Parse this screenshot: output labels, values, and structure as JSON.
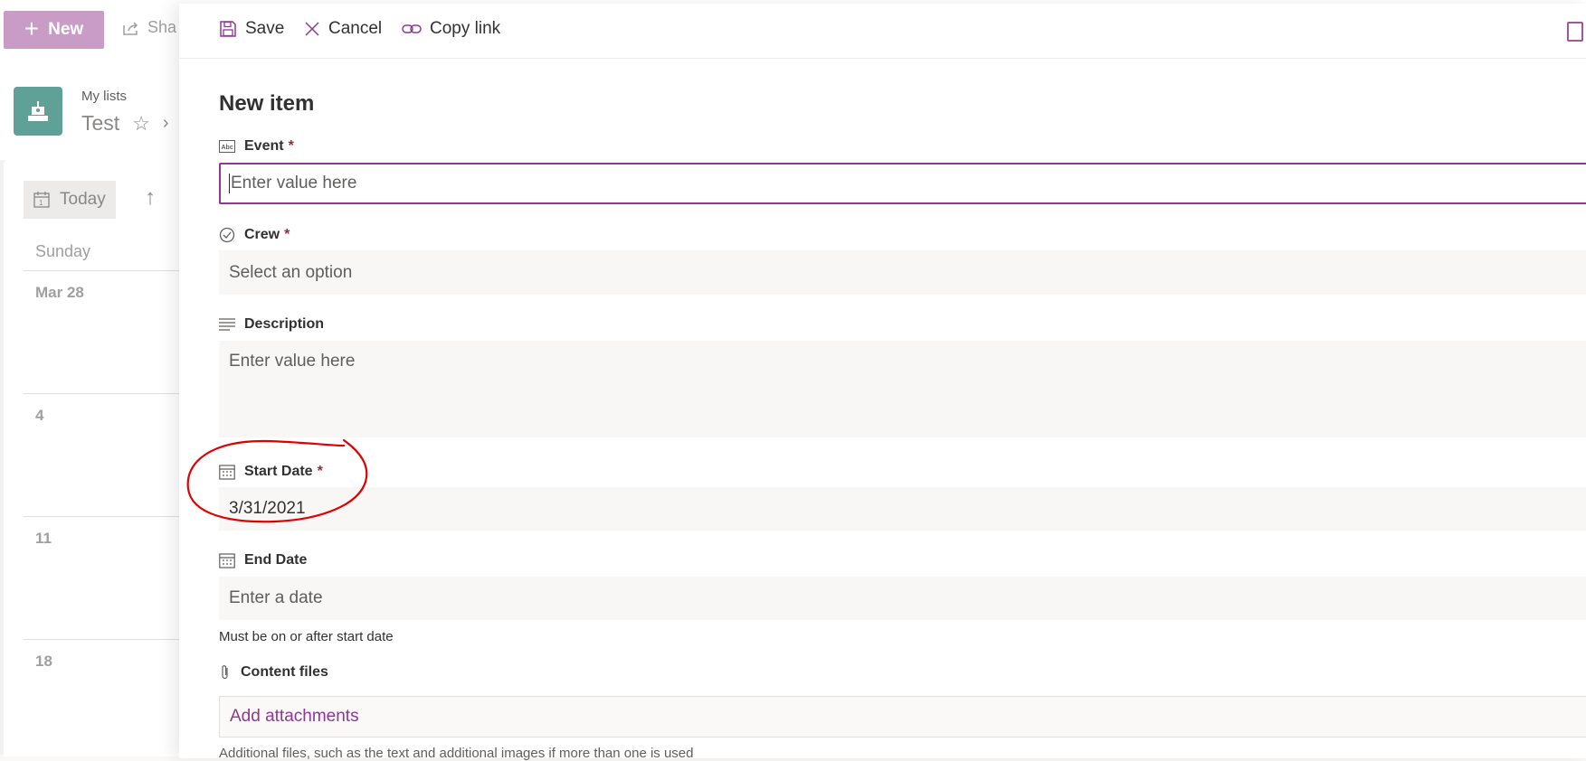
{
  "background": {
    "command_bar": {
      "new_label": "New",
      "share_label": "Sha"
    },
    "site": {
      "parent_breadcrumb": "My lists",
      "list_title": "Test"
    },
    "calendar": {
      "today_label": "Today",
      "day_of_week": "Sunday",
      "rows": [
        "Mar 28",
        "4",
        "11",
        "18"
      ]
    }
  },
  "panel": {
    "command_bar": {
      "save_label": "Save",
      "cancel_label": "Cancel",
      "copy_link_label": "Copy link"
    },
    "title": "New item",
    "fields": {
      "event": {
        "label": "Event",
        "required_mark": "*",
        "placeholder": "Enter value here"
      },
      "crew": {
        "label": "Crew",
        "required_mark": "*",
        "placeholder": "Select an option"
      },
      "description": {
        "label": "Description",
        "placeholder": "Enter value here"
      },
      "start_date": {
        "label": "Start Date",
        "required_mark": "*",
        "value": "3/31/2021"
      },
      "end_date": {
        "label": "End Date",
        "placeholder": "Enter a date",
        "helper": "Must be on or after start date"
      },
      "content_files": {
        "label": "Content files",
        "link_label": "Add attachments",
        "helper": "Additional files, such as the text and additional images if more than one is used"
      }
    }
  },
  "colors": {
    "accent": "#8b3a8f",
    "new_button": "#c89cc4",
    "site_logo": "#5fa097",
    "required": "#a4262c",
    "annotation": "#e00000"
  },
  "icons": {
    "save": "floppy-disk",
    "cancel": "x-mark",
    "copy_link": "link",
    "event": "text-abc",
    "crew": "check-circle",
    "description": "multi-line-text",
    "dates": "calendar",
    "content_files": "paperclip"
  }
}
